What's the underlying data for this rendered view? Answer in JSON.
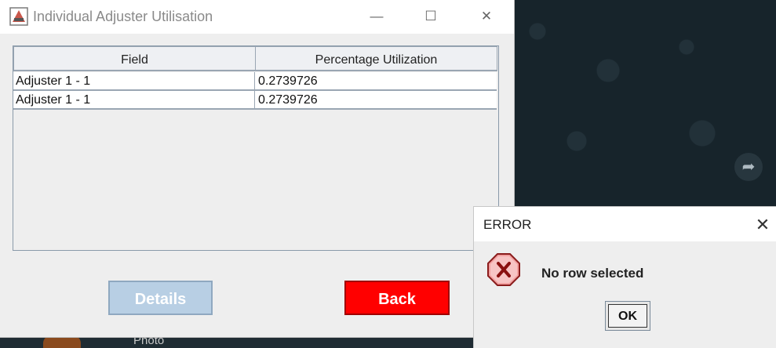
{
  "main_window": {
    "title": "Individual Adjuster Utilisation",
    "controls": {
      "minimize": "—",
      "maximize": "☐",
      "close": "✕"
    },
    "table": {
      "headers": [
        "Field",
        "Percentage Utilization"
      ],
      "rows": [
        [
          "Adjuster 1 - 1",
          "0.2739726"
        ],
        [
          "Adjuster 1 - 1",
          "0.2739726"
        ]
      ]
    },
    "buttons": {
      "details": "Details",
      "back": "Back"
    },
    "colors": {
      "back_button": "#ff0000",
      "details_button": "#b8cfe4"
    }
  },
  "error_dialog": {
    "title": "ERROR",
    "close": "✕",
    "message": "No row selected",
    "ok": "OK",
    "icon": "error-icon"
  },
  "background": {
    "forward_icon": "➦",
    "photo_label": "Photo"
  }
}
